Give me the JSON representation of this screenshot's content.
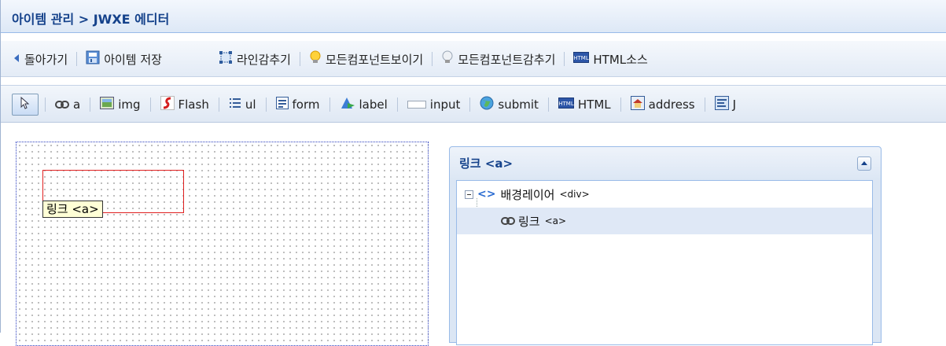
{
  "window": {
    "title": "아이템 관리 > JWXE 에디터"
  },
  "toolbar1": {
    "items": [
      {
        "label": "돌아가기",
        "icon": "back-arrow-icon"
      },
      {
        "label": "아이템 저장",
        "icon": "save-icon"
      },
      {
        "label": "라인감추기",
        "icon": "hide-lines-icon"
      },
      {
        "label": "모든컴포넌트보이기",
        "icon": "lightbulb-on-icon"
      },
      {
        "label": "모든컴포넌트감추기",
        "icon": "lightbulb-off-icon"
      },
      {
        "label": "HTML소스",
        "icon": "html-source-icon"
      }
    ]
  },
  "toolbar2": {
    "items": [
      {
        "label": "",
        "icon": "pointer-icon",
        "active": true
      },
      {
        "label": "a",
        "icon": "link-chain-icon"
      },
      {
        "label": "img",
        "icon": "image-icon"
      },
      {
        "label": "Flash",
        "icon": "flash-icon"
      },
      {
        "label": "ul",
        "icon": "list-icon"
      },
      {
        "label": "form",
        "icon": "form-icon"
      },
      {
        "label": "label",
        "icon": "label-icon"
      },
      {
        "label": "input",
        "icon": "input-icon"
      },
      {
        "label": "submit",
        "icon": "submit-globe-icon"
      },
      {
        "label": "HTML",
        "icon": "html-icon"
      },
      {
        "label": "address",
        "icon": "address-icon"
      },
      {
        "label": "J",
        "icon": "script-icon"
      }
    ]
  },
  "canvas": {
    "selected_element_label": "링크 <a>"
  },
  "panel": {
    "title": "링크 <a>",
    "tree": [
      {
        "label": "배경레이어",
        "tag": "<div>",
        "icon": "code-brackets-icon",
        "expanded": true
      },
      {
        "label": "링크",
        "tag": "<a>",
        "icon": "link-chain-icon",
        "selected": true
      }
    ]
  },
  "colors": {
    "title_text": "#15428b",
    "selection_border": "#e02020",
    "tree_selected_bg": "#dfe8f6"
  }
}
